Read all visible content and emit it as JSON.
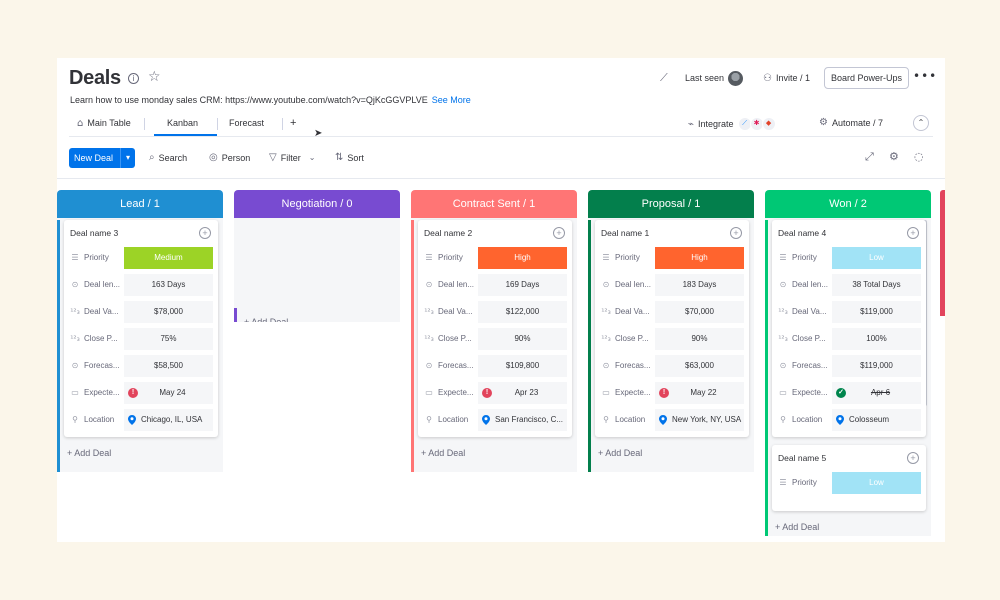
{
  "header": {
    "title": "Deals",
    "description": "Learn how to use monday sales CRM: https://www.youtube.com/watch?v=QjKcGGVPLVE",
    "see_more": "See More",
    "last_seen": "Last seen",
    "invite": "Invite / 1",
    "board_powerups": "Board Power-Ups"
  },
  "tabs": [
    {
      "label": "Main Table",
      "active": false
    },
    {
      "label": "Kanban",
      "active": true
    },
    {
      "label": "Forecast",
      "active": false
    },
    {
      "label": "+",
      "active": false
    }
  ],
  "integrate_label": "Integrate",
  "automate_label": "Automate / 7",
  "toolbar": {
    "new_deal": "New Deal",
    "search": "Search",
    "person": "Person",
    "filter": "Filter",
    "sort": "Sort"
  },
  "add_deal_label": "+ Add Deal",
  "field_labels": {
    "priority": "Priority",
    "deal_length": "Deal len...",
    "deal_value": "Deal Va...",
    "close_prob": "Close P...",
    "forecast": "Forecas...",
    "expected": "Expecte...",
    "location": "Location"
  },
  "columns": [
    {
      "title": "Lead / 1",
      "color": "#1f8fd2",
      "cards": [
        {
          "name": "Deal name 3",
          "priority": "Medium",
          "priority_color": "#9cd326",
          "deal_length": "163 Days",
          "deal_value": "$78,000",
          "close_prob": "75%",
          "forecast": "$58,500",
          "expected": "May 24",
          "location": "Chicago, IL, USA"
        }
      ]
    },
    {
      "title": "Negotiation / 0",
      "color": "#784bd1",
      "cards": []
    },
    {
      "title": "Contract Sent / 1",
      "color": "#ff7575",
      "cards": [
        {
          "name": "Deal name 2",
          "priority": "High",
          "priority_color": "#ff642e",
          "deal_length": "169 Days",
          "deal_value": "$122,000",
          "close_prob": "90%",
          "forecast": "$109,800",
          "expected": "Apr 23",
          "location": "San Francisco, C..."
        }
      ]
    },
    {
      "title": "Proposal / 1",
      "color": "#037f4c",
      "cards": [
        {
          "name": "Deal name 1",
          "priority": "High",
          "priority_color": "#ff642e",
          "deal_length": "183 Days",
          "deal_value": "$70,000",
          "close_prob": "90%",
          "forecast": "$63,000",
          "expected": "May 22",
          "location": "New York, NY, USA"
        }
      ]
    },
    {
      "title": "Won / 2",
      "color": "#00c875",
      "cards": [
        {
          "name": "Deal name 4",
          "priority": "Low",
          "priority_color": "#a1e3f6",
          "deal_length": "38 Total Days",
          "deal_value": "$119,000",
          "close_prob": "100%",
          "forecast": "$119,000",
          "expected": "Apr 6",
          "location": "Colosseum"
        },
        {
          "name": "Deal name 5",
          "priority": "Low",
          "priority_color": "#a1e3f6"
        }
      ]
    }
  ]
}
